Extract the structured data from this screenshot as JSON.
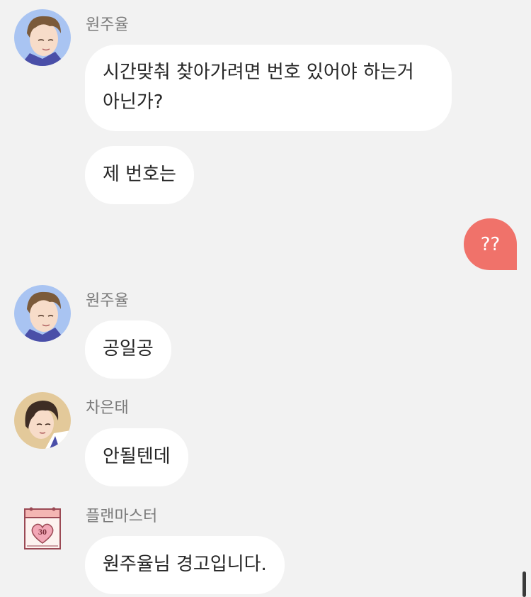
{
  "chat": {
    "groups": [
      {
        "sender": "원주율",
        "avatar_icon": "young-man-short-hair-avatar-icon",
        "messages": [
          "시간맞춰 찾아가려면 번호 있어야 하는거 아닌가?",
          "제 번호는"
        ]
      },
      {
        "sender": "원주율",
        "avatar_icon": "young-man-short-hair-avatar-icon",
        "messages": [
          "공일공"
        ]
      },
      {
        "sender": "차은태",
        "avatar_icon": "man-dark-hair-avatar-icon",
        "messages": [
          "안될텐데"
        ]
      },
      {
        "sender": "플랜마스터",
        "avatar_icon": "calendar-heart-icon",
        "avatar_text": "30",
        "messages": [
          "원주율님 경고입니다."
        ]
      }
    ],
    "my_messages": [
      "??"
    ]
  },
  "colors": {
    "background": "#f2f2f2",
    "bubble_other": "#ffffff",
    "bubble_mine": "#f0726a",
    "name_text": "#7a7a7a"
  }
}
